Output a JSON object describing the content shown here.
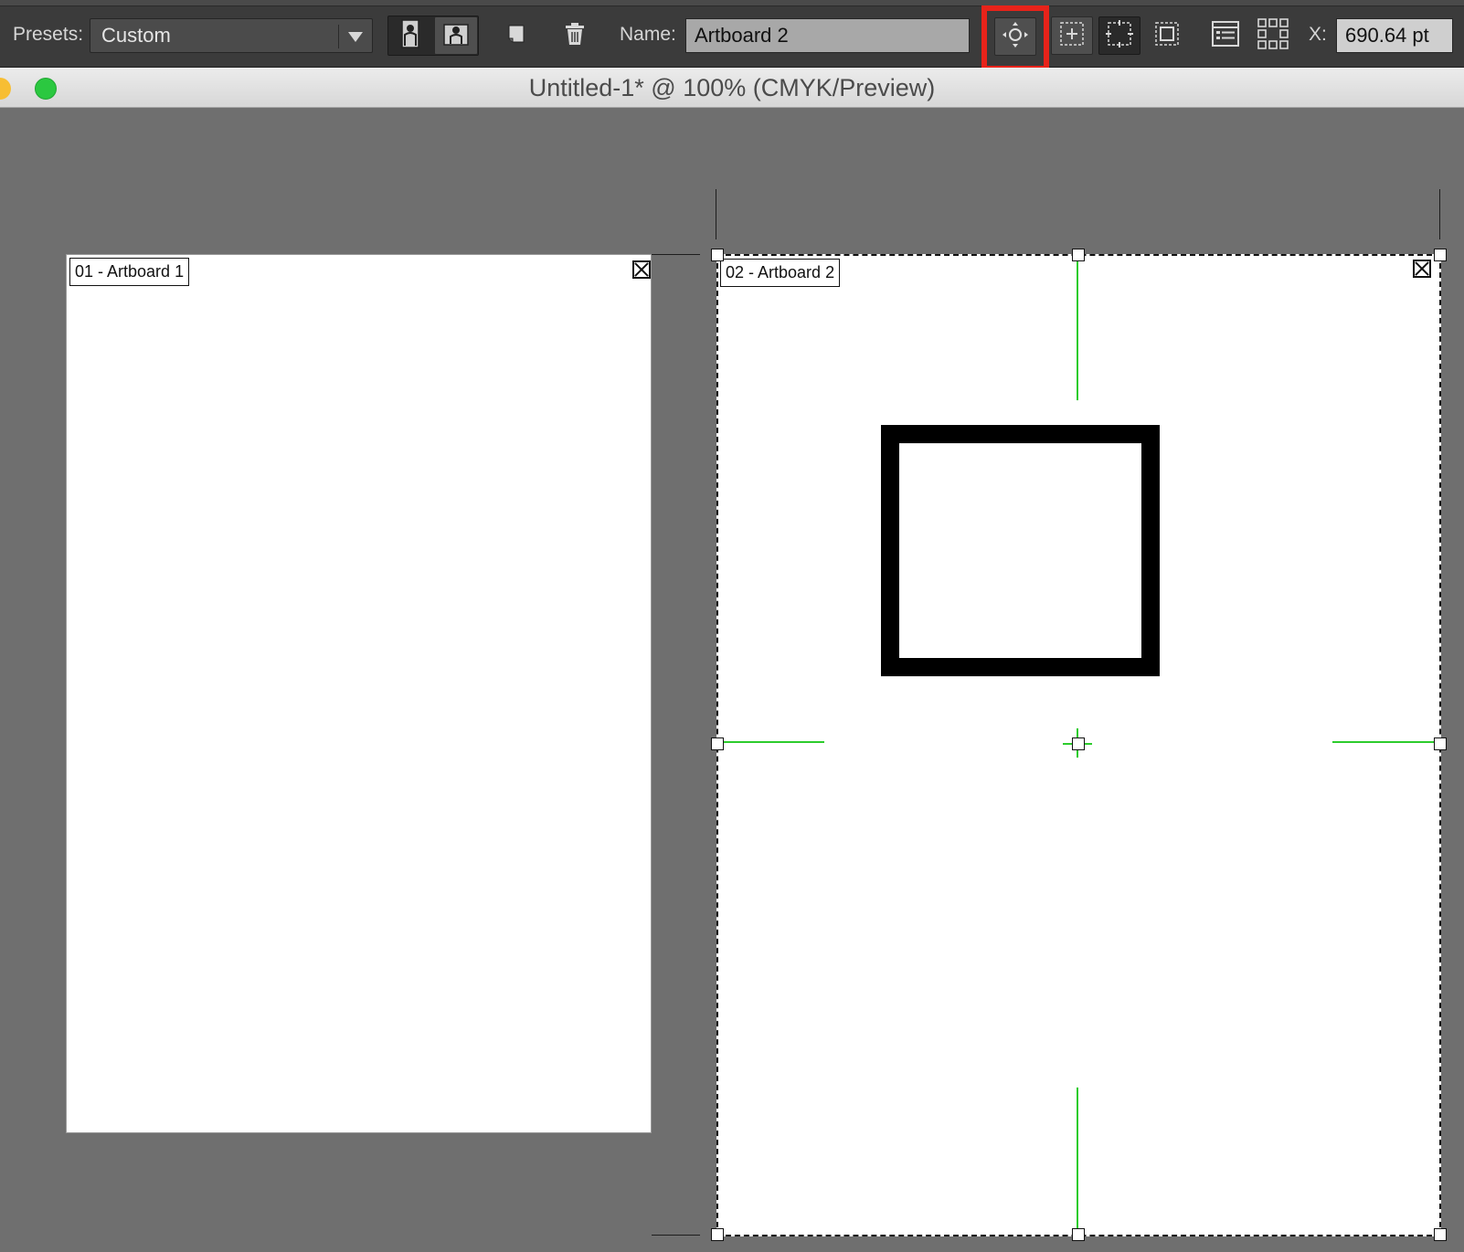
{
  "toolbar": {
    "presets_label": "Presets:",
    "presets_value": "Custom",
    "name_label": "Name:",
    "name_value": "Artboard 2",
    "x_label": "X:",
    "x_value": "690.64 pt",
    "icons": [
      "portrait-icon",
      "landscape-icon",
      "new-artboard-icon",
      "trash-icon",
      "move-copy-artwork-icon",
      "show-center-mark-icon",
      "show-cross-hairs-icon",
      "show-video-safe-areas-icon",
      "artboard-options-icon",
      "rearrange-artboards-icon"
    ],
    "highlight_color": "#e8231a"
  },
  "document": {
    "title": "Untitled-1* @ 100% (CMYK/Preview)"
  },
  "artboards": [
    {
      "label": "01 - Artboard 1"
    },
    {
      "label": "02 - Artboard 2"
    }
  ],
  "colors": {
    "canvas": "#6f6f6f",
    "guide_green": "#2ccc2c",
    "toolbar": "#3b3b3b"
  }
}
